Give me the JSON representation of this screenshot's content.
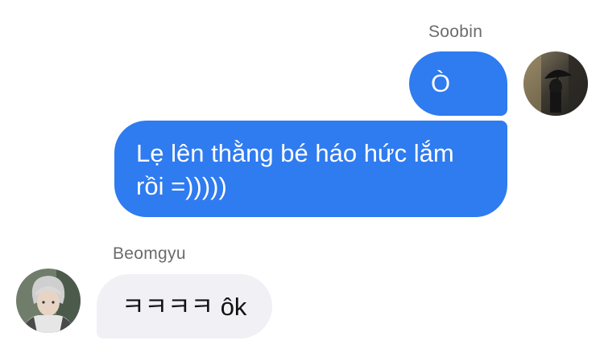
{
  "conversation": {
    "outgoing": {
      "sender_name": "Soobin",
      "avatar_icon": "profile-photo-umbrella-icon",
      "messages": [
        {
          "text": "Ò"
        },
        {
          "lines": [
            "Lẹ lên thằng bé háo hức lắm",
            "rồi =)))))"
          ]
        }
      ]
    },
    "incoming": {
      "sender_name": "Beomgyu",
      "avatar_icon": "profile-photo-person-icon",
      "messages": [
        {
          "text": "ㅋㅋㅋㅋ ôk"
        }
      ]
    }
  },
  "colors": {
    "outgoing_bubble": "#2f7bf0",
    "incoming_bubble": "#f0f0f5",
    "name_text": "#6b6b6e"
  }
}
